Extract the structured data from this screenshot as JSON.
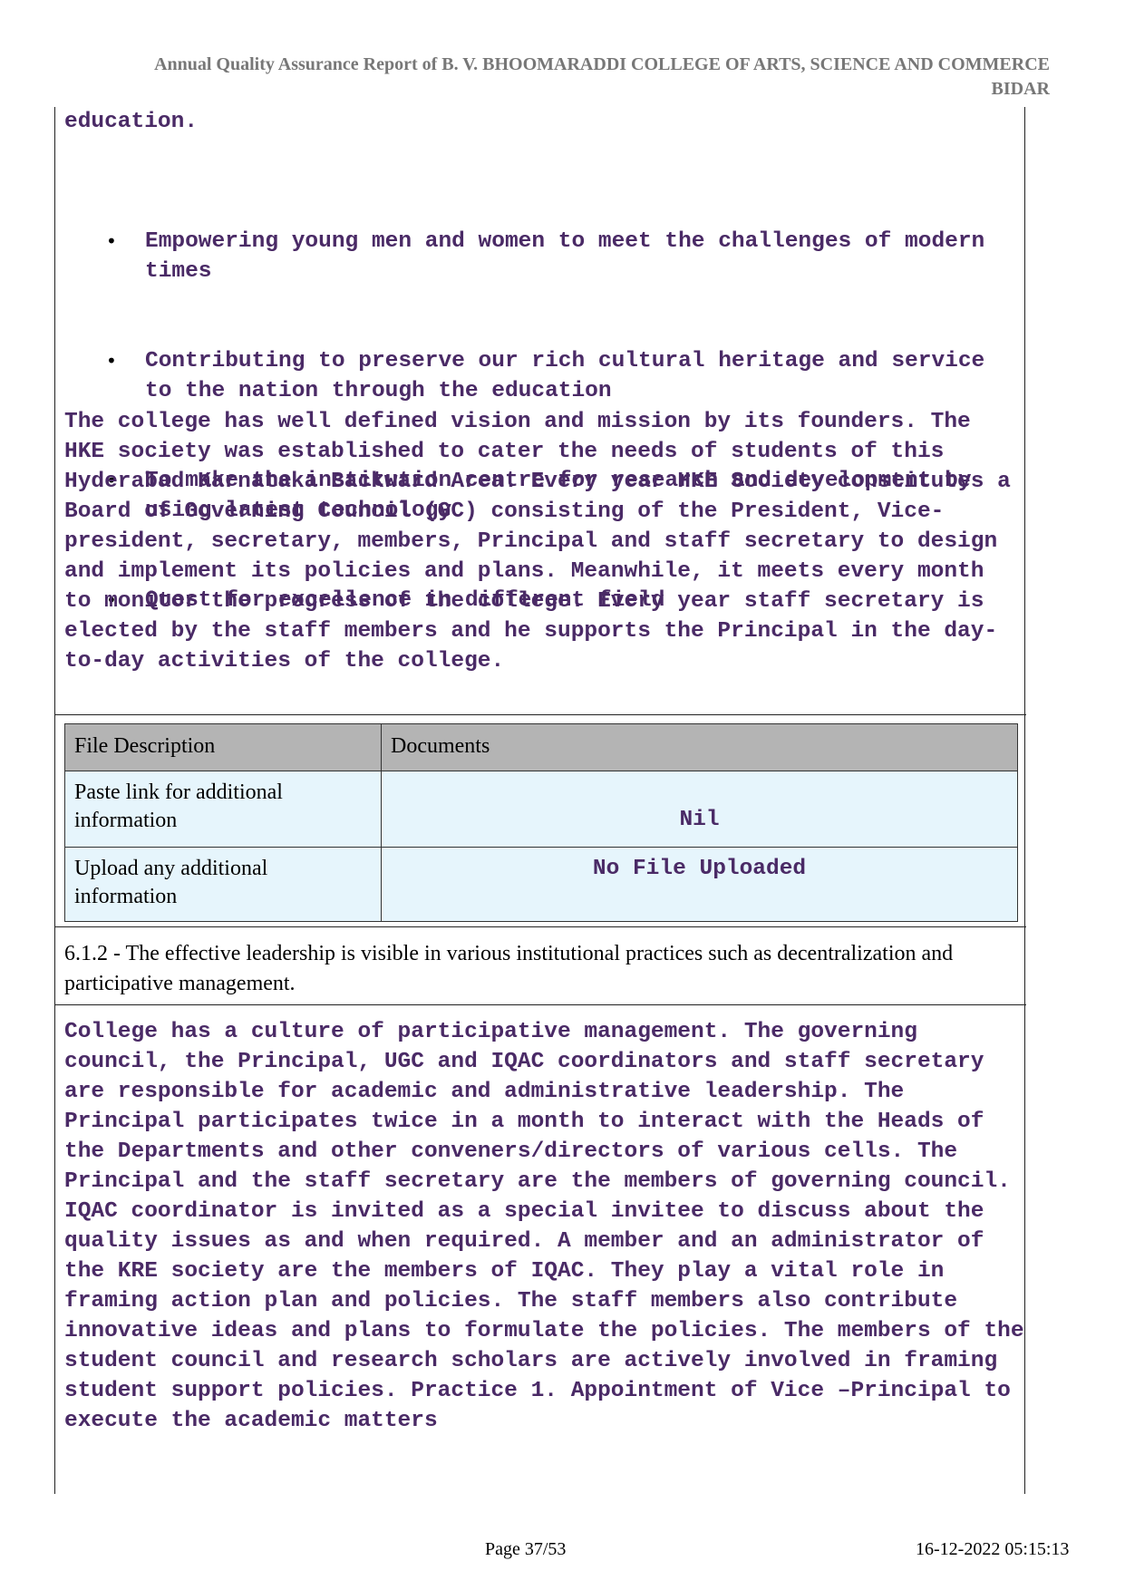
{
  "header": {
    "line1": "Annual Quality Assurance Report of B. V. BHOOMARADDI COLLEGE OF ARTS, SCIENCE AND COMMERCE",
    "line2": "BIDAR"
  },
  "continued_text": "education.",
  "bullets": [
    "Empowering young men and women to meet the challenges of modern times",
    "Contributing to preserve our rich cultural heritage and service to the nation through the education",
    "To make the institution centre for research and development by using latest technology",
    "Quest for excellence in different field"
  ],
  "paragraph1": "The college has well defined vision and mission by its founders. The HKE society was established to cater the needs of students of this Hyderabad Karnataka Backward Area. Every year HKE Society constitutes a Board of Governing Council (GC) consisting of the President, Vice-president, secretary, members, Principal and staff secretary to design and implement its policies and plans. Meanwhile, it meets every month to monitor the progress of the college. Every year staff secretary is elected by the staff members and he supports the Principal in the day-to-day activities of the college.",
  "file_table": {
    "headers": [
      "File Description",
      "Documents"
    ],
    "rows": [
      {
        "description": "Paste link for additional information",
        "document": "Nil"
      },
      {
        "description": "Upload any additional information",
        "document": "No File Uploaded"
      }
    ]
  },
  "question": "6.1.2 - The effective leadership is visible in various institutional practices such as decentralization and participative management.",
  "paragraph2": "College has a culture of participative management. The governing council, the Principal, UGC and IQAC coordinators and staff secretary are responsible for academic and administrative leadership. The Principal participates twice in a month to interact with the Heads of the Departments and other conveners/directors of various cells. The Principal and the staff secretary are the members of governing council. IQAC coordinator is invited as a special invitee to discuss about the quality issues as and when required. A member and an administrator of the KRE society are the members of IQAC. They play a vital role in framing action plan and policies. The staff members also contribute innovative ideas and plans to formulate the policies. The members of the student council and research scholars are actively involved in framing student support policies. Practice 1. Appointment of Vice –Principal to execute the academic matters",
  "footer": {
    "page": "Page 37/53",
    "timestamp": "16-12-2022 05:15:13"
  }
}
